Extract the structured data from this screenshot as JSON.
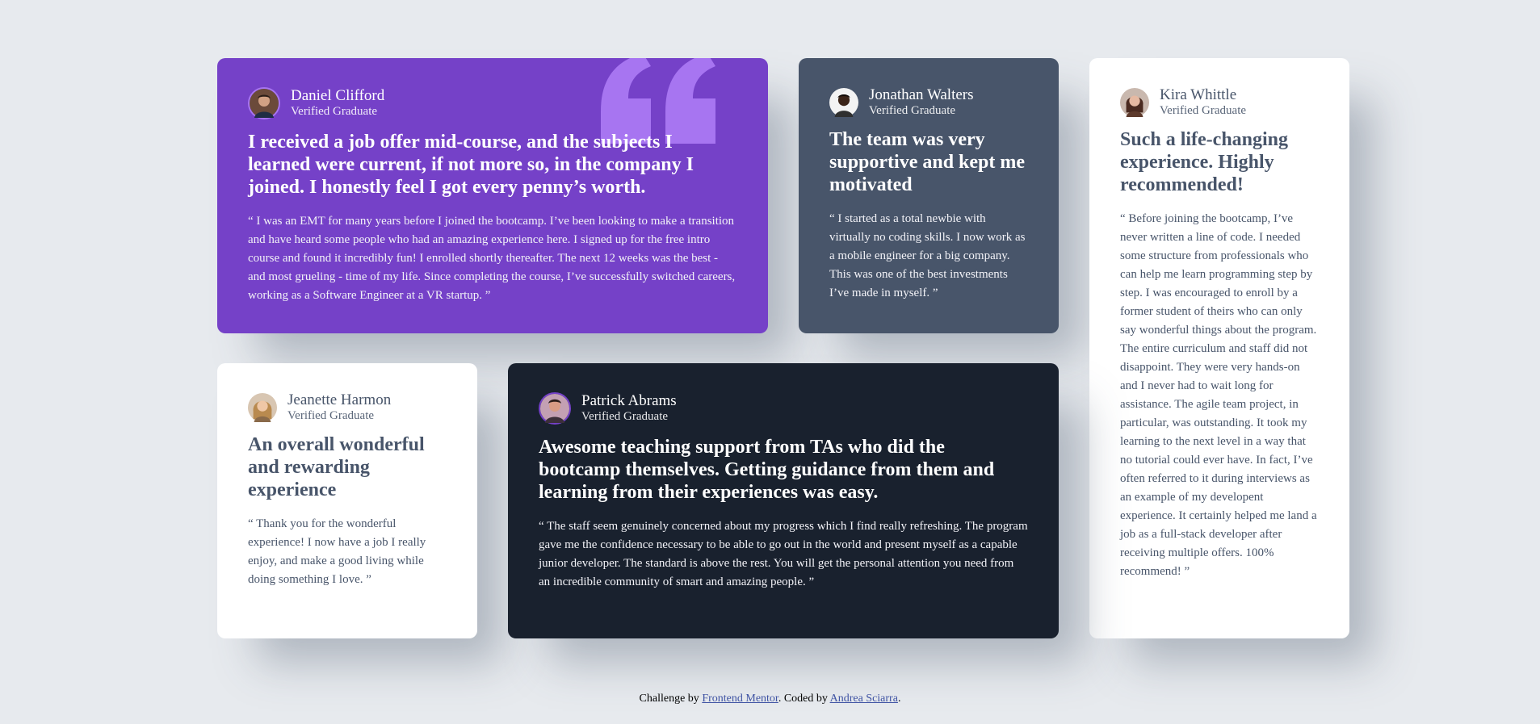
{
  "testimonials": [
    {
      "name": "Daniel Clifford",
      "role": "Verified Graduate",
      "headline": "I received a job offer mid-course, and the subjects I learned were current, if not more so, in the company I joined. I honestly feel I got every penny’s worth.",
      "body": "“ I was an EMT for many years before I joined the bootcamp. I’ve been looking to make a transition and have heard some people who had an amazing experience here. I signed up for the free intro course and found it incredibly fun! I enrolled shortly thereafter. The next 12 weeks was the best - and most grueling - time of my life. Since completing the course, I’ve successfully switched careers, working as a Software Engineer at a VR startup. ”",
      "card_color": "#7541c8"
    },
    {
      "name": "Jonathan Walters",
      "role": "Verified Graduate",
      "headline": "The team was very supportive and kept me motivated",
      "body": "“ I started as a total newbie with virtually no coding skills. I now work as a mobile engineer for a big company. This was one of the best investments I’ve made in myself. ”",
      "card_color": "#48556a"
    },
    {
      "name": "Kira Whittle",
      "role": "Verified Graduate",
      "headline": "Such a life-changing experience. Highly recommended!",
      "body": "“ Before joining the bootcamp, I’ve never written a line of code. I needed some structure from professionals who can help me learn programming step by step. I was encouraged to enroll by a former student of theirs who can only say wonderful things about the program. The entire curriculum and staff did not disappoint. They were very hands-on and I never had to wait long for assistance. The agile team project, in particular, was outstanding. It took my learning to the next level in a way that no tutorial could ever have. In fact, I’ve often referred to it during interviews as an example of my developent experience. It certainly helped me land a job as a full-stack developer after receiving multiple offers. 100% recommend! ”",
      "card_color": "#ffffff"
    },
    {
      "name": "Jeanette Harmon",
      "role": "Verified Graduate",
      "headline": "An overall wonderful and rewarding experience",
      "body": "“ Thank you for the wonderful experience! I now have a job I really enjoy, and make a good living while doing something I love. ”",
      "card_color": "#ffffff"
    },
    {
      "name": "Patrick Abrams",
      "role": "Verified Graduate",
      "headline": "Awesome teaching support from TAs who did the bootcamp themselves. Getting guidance from them and learning from their experiences was easy.",
      "body": "“ The staff seem genuinely concerned about my progress which I find really refreshing. The program gave me the confidence necessary to be able to go out in the world and present myself as a capable junior developer. The standard is above the rest. You will get the personal attention you need from an incredible community of smart and amazing people. ”",
      "card_color": "#19212e"
    }
  ],
  "footer": {
    "prefix": "Challenge by ",
    "challenge_link": "Frontend Mentor",
    "middle": ". Coded by ",
    "author_link": "Andrea Sciarra",
    "suffix": "."
  },
  "colors": {
    "background": "#e7eaee",
    "purple": "#7541c8",
    "grayish_blue": "#48556a",
    "dark_blackish_blue": "#19212e",
    "quote_mark": "#a775f1"
  }
}
